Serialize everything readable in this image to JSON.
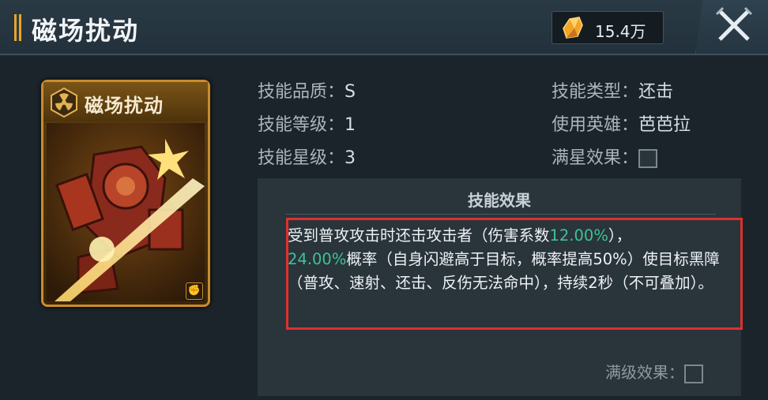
{
  "header": {
    "title": "磁场扰动",
    "currency_value": "15.4万",
    "currency_icon": "gold-crystal-icon",
    "close_icon": "crossed-swords-close-icon"
  },
  "card": {
    "title": "磁场扰动",
    "emblem_icon": "radiation-emblem-icon",
    "corner_icon": "fist-icon"
  },
  "info": {
    "quality_label": "技能品质：",
    "quality_value": "S",
    "level_label": "技能等级：",
    "level_value": "1",
    "star_label": "技能星级：",
    "star_value": "3",
    "type_label": "技能类型：",
    "type_value": "还击",
    "hero_label": "使用英雄：",
    "hero_value": "芭芭拉",
    "full_star_label": "满星效果："
  },
  "effect": {
    "title": "技能效果",
    "seg1": "受到普攻攻击时还击攻击者（伤害系数",
    "seg2": "12.00%",
    "seg3": "），",
    "seg4": "24.00%",
    "seg5": "概率（自身闪避高于目标，概率提高50%）使目标黑障（普攻、速射、还击、反伤无法命中），持续2秒（不可叠加）。",
    "max_level_label": "满级效果：",
    "highlight_color": "#3fc395",
    "box_color": "#e0302b"
  }
}
